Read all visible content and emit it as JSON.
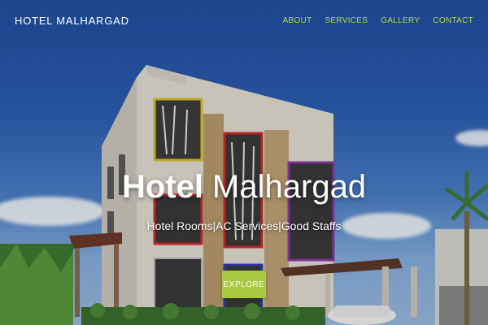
{
  "nav": {
    "brand": "HOTEL MALHARGAD",
    "items": [
      {
        "label": "ABOUT"
      },
      {
        "label": "SERVICES"
      },
      {
        "label": "GALLERY"
      },
      {
        "label": "CONTACT"
      }
    ]
  },
  "hero": {
    "title_bold": "Hotel",
    "title_light": " Malhargad",
    "tagline": "Hotel Rooms|AC Services|Good Staffs",
    "button": "EXPLORE"
  },
  "colors": {
    "accent": "#a9c93e",
    "nav_link": "#b9d84a",
    "sky": "#2d5fb3"
  }
}
